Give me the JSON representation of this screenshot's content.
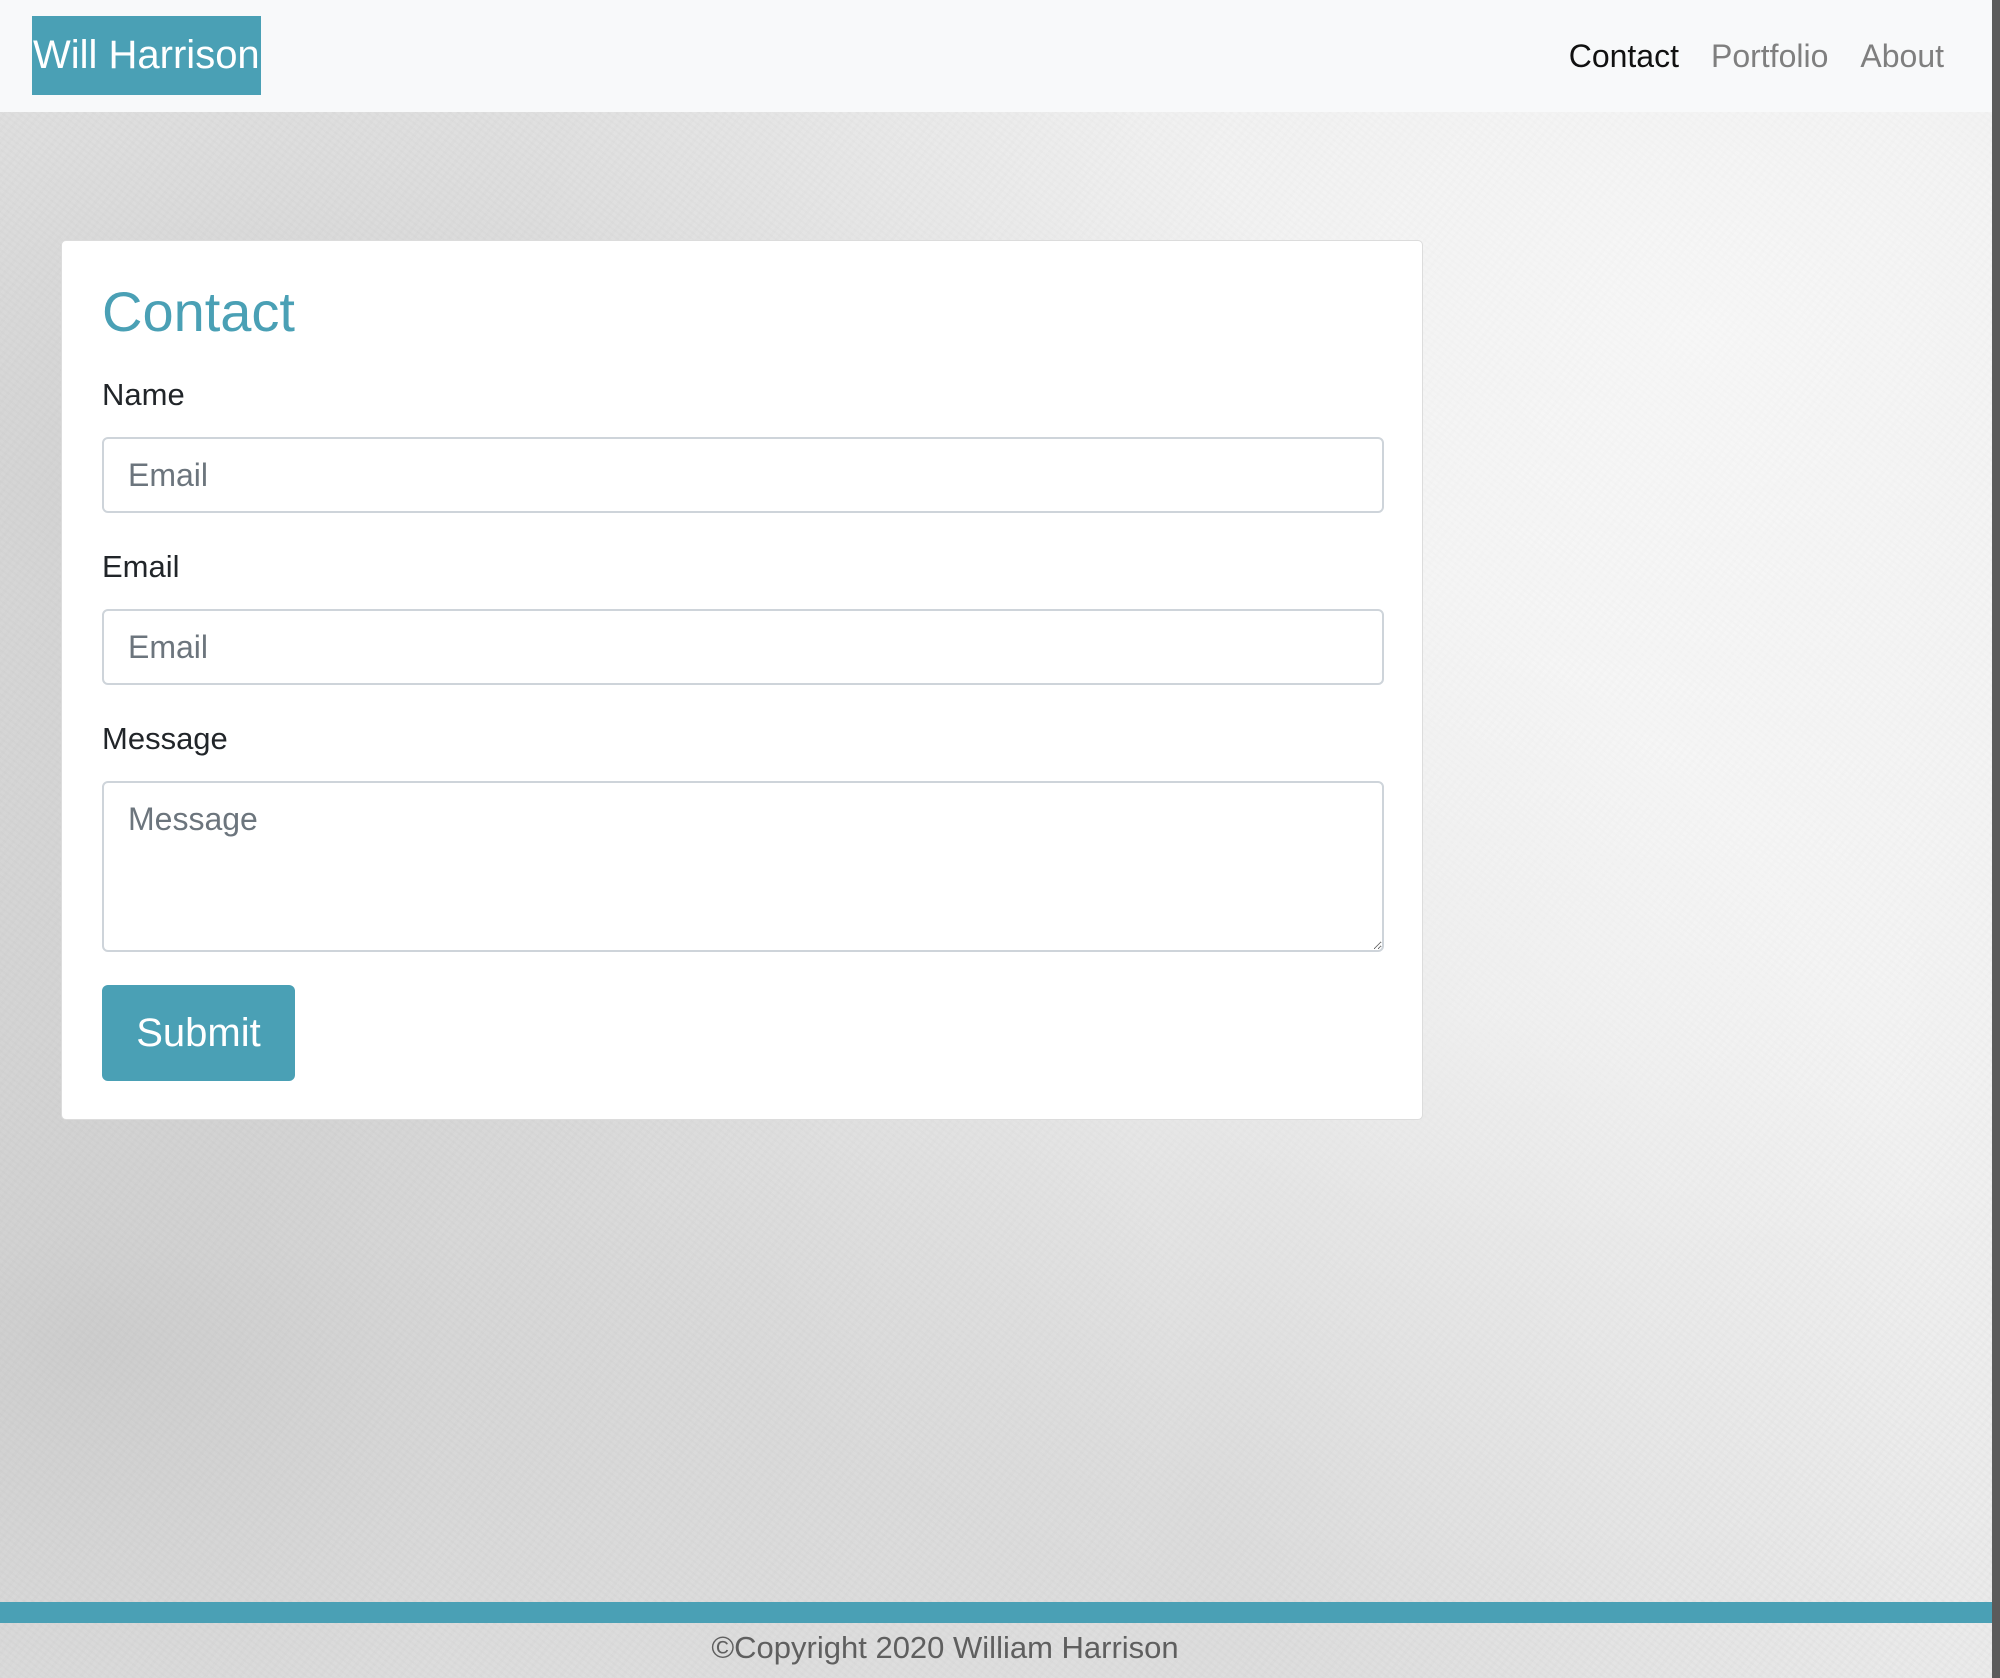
{
  "navbar": {
    "brand": "Will Harrison",
    "links": [
      {
        "label": "Contact",
        "active": true
      },
      {
        "label": "Portfolio",
        "active": false
      },
      {
        "label": "About",
        "active": false
      }
    ]
  },
  "contact_form": {
    "title": "Contact",
    "name": {
      "label": "Name",
      "placeholder": "Email",
      "value": ""
    },
    "email": {
      "label": "Email",
      "placeholder": "Email",
      "value": ""
    },
    "message": {
      "label": "Message",
      "placeholder": "Message",
      "value": ""
    },
    "submit_label": "Submit"
  },
  "footer": {
    "copyright": "©Copyright 2020 William Harrison"
  },
  "colors": {
    "accent": "#4aa0b5",
    "navbar_bg": "#f8f9fa",
    "nav_link_active": "#111111",
    "nav_link_inactive": "#7f7f7f"
  }
}
